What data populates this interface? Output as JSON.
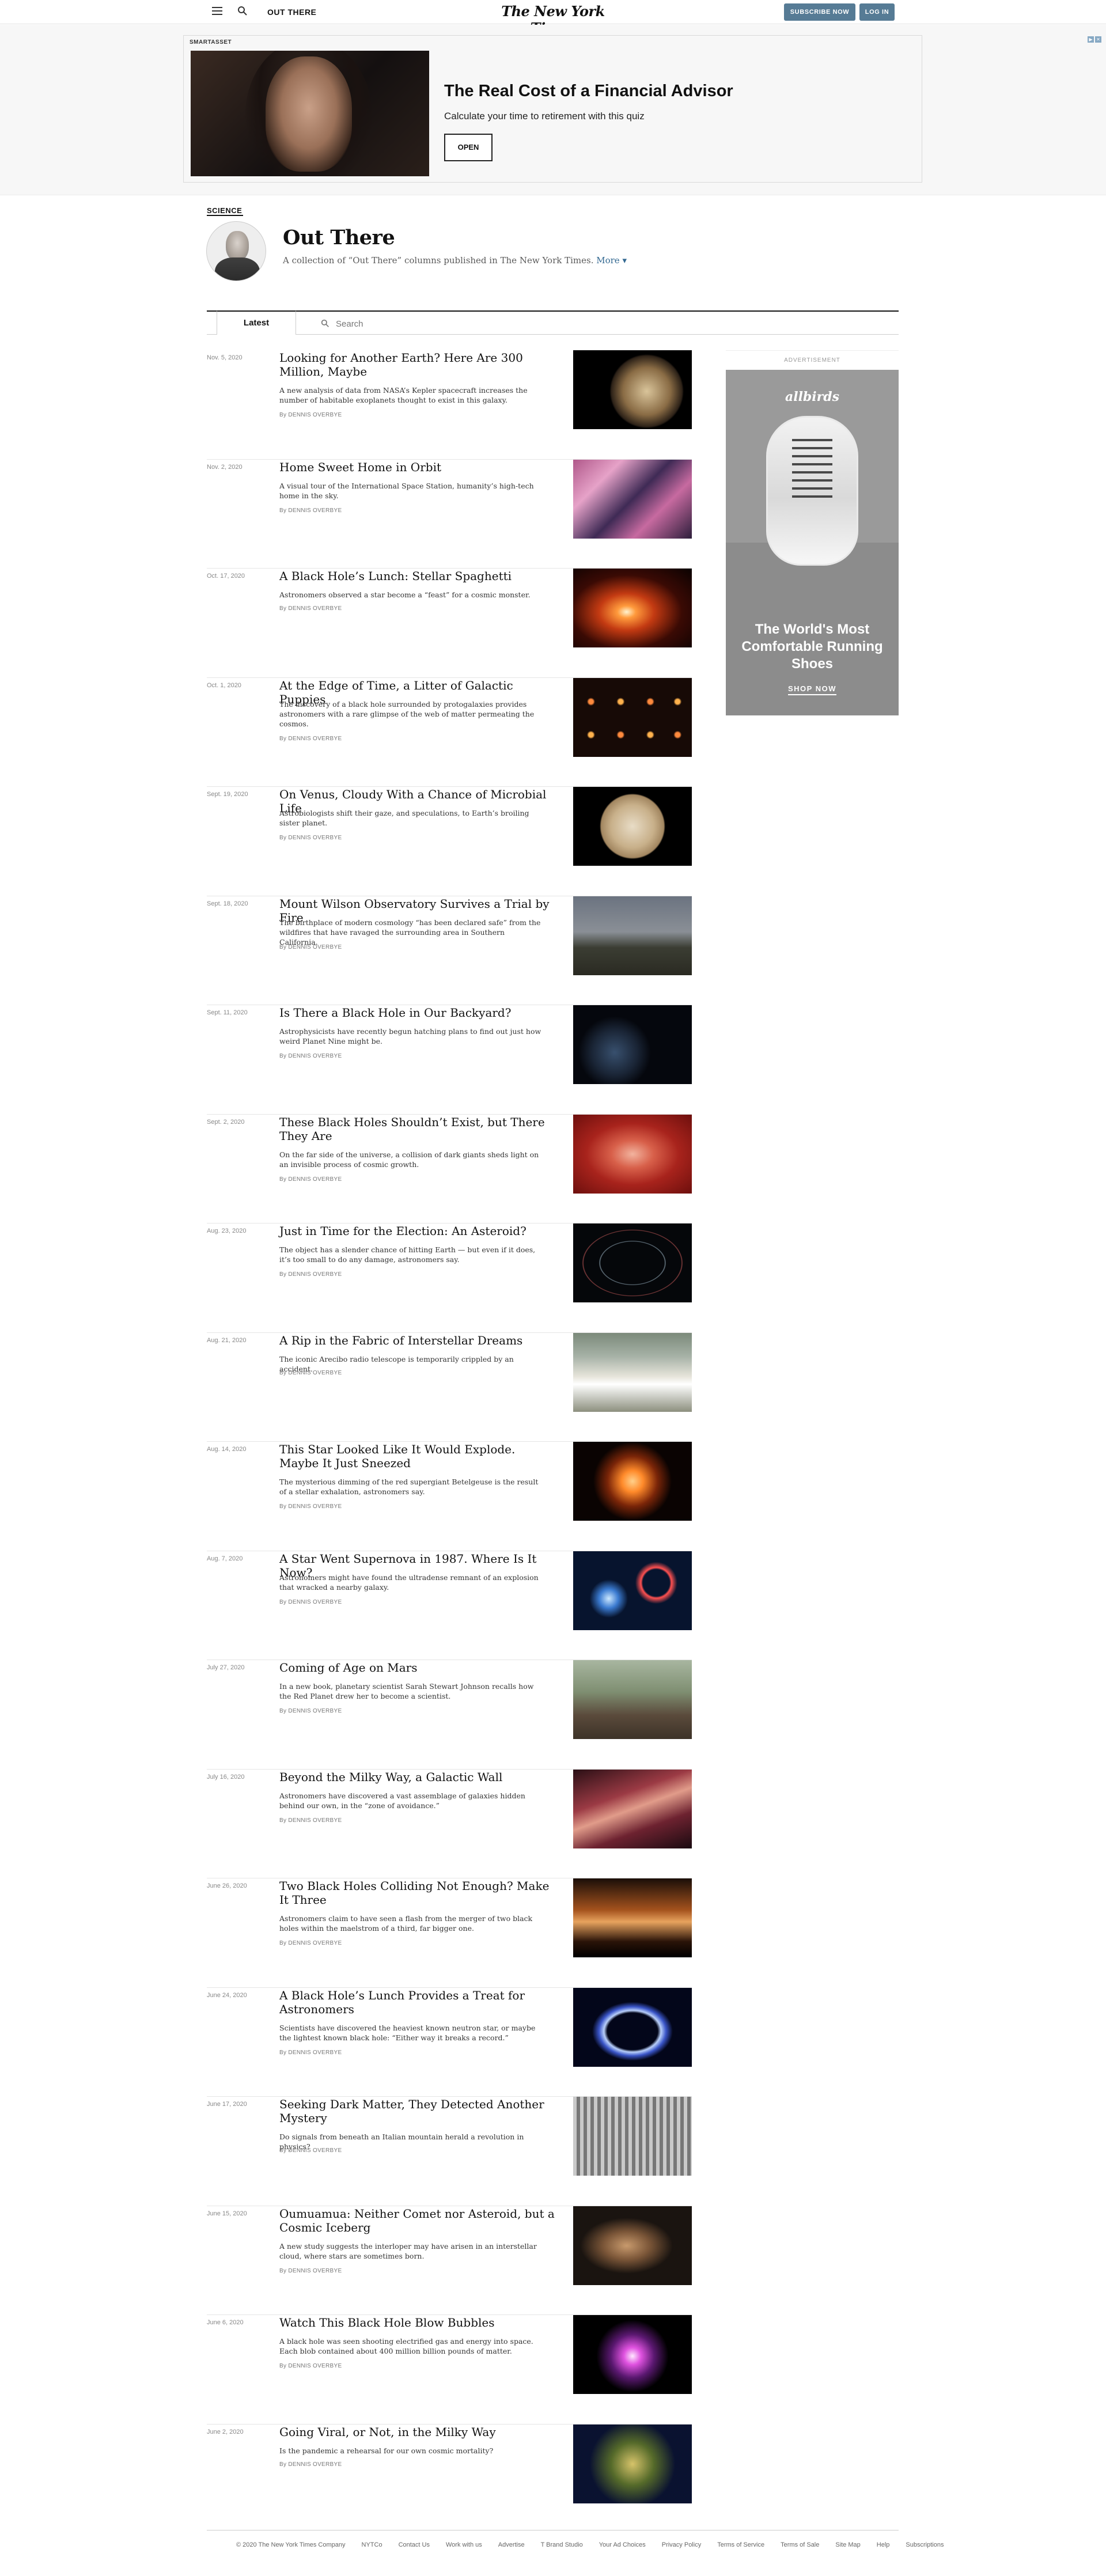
{
  "topbar": {
    "section_label": "OUT THERE",
    "logo": "The New York Times",
    "subscribe_label": "SUBSCRIBE NOW",
    "login_label": "LOG IN",
    "button_color": "#567b95"
  },
  "ad": {
    "tag": "SMARTASSET",
    "title": "The Real Cost of a Financial Advisor",
    "subtitle": "Calculate your time to retirement with this quiz",
    "button_label": "OPEN"
  },
  "column": {
    "kicker": "SCIENCE",
    "title": "Out There",
    "description": "A collection of “Out There” columns published in The New York Times.",
    "more_label": "More"
  },
  "tabs": {
    "latest_label": "Latest",
    "search_placeholder": "Search"
  },
  "articles": [
    {
      "date": "Nov. 5, 2020",
      "title": "Looking for Another Earth? Here Are 300 Million, Maybe",
      "summary": "A new analysis of data from NASA’s Kepler spacecraft increases the number of habitable exoplanets thought to exist in this galaxy.",
      "byline": "By DENNIS OVERBYE"
    },
    {
      "date": "Nov. 2, 2020",
      "title": "Home Sweet Home in Orbit",
      "summary": "A visual tour of the International Space Station, humanity’s high-tech home in the sky.",
      "byline": "By DENNIS OVERBYE"
    },
    {
      "date": "Oct. 17, 2020",
      "title": "A Black Hole’s Lunch: Stellar Spaghetti",
      "summary": "Astronomers observed a star become a “feast” for a cosmic monster.",
      "byline": "By DENNIS OVERBYE"
    },
    {
      "date": "Oct. 1, 2020",
      "title": "At the Edge of Time, a Litter of Galactic Puppies",
      "summary": "The discovery of a black hole surrounded by protogalaxies provides astronomers with a rare glimpse of the web of matter permeating the cosmos.",
      "byline": "By DENNIS OVERBYE"
    },
    {
      "date": "Sept. 19, 2020",
      "title": "On Venus, Cloudy With a Chance of Microbial Life",
      "summary": "Astrobiologists shift their gaze, and speculations, to Earth’s broiling sister planet.",
      "byline": "By DENNIS OVERBYE"
    },
    {
      "date": "Sept. 18, 2020",
      "title": "Mount Wilson Observatory Survives a Trial by Fire",
      "summary": "The birthplace of modern cosmology “has been declared safe” from the wildfires that have ravaged the surrounding area in Southern California.",
      "byline": "By DENNIS OVERBYE"
    },
    {
      "date": "Sept. 11, 2020",
      "title": "Is There a Black Hole in Our Backyard?",
      "summary": "Astrophysicists have recently begun hatching plans to find out just how weird Planet Nine might be.",
      "byline": "By DENNIS OVERBYE"
    },
    {
      "date": "Sept. 2, 2020",
      "title": "These Black Holes Shouldn’t Exist, but There They Are",
      "summary": "On the far side of the universe, a collision of dark giants sheds light on an invisible process of cosmic growth.",
      "byline": "By DENNIS OVERBYE"
    },
    {
      "date": "Aug. 23, 2020",
      "title": "Just in Time for the Election: An Asteroid?",
      "summary": "The object has a slender chance of hitting Earth — but even if it does, it’s too small to do any damage, astronomers say.",
      "byline": "By DENNIS OVERBYE"
    },
    {
      "date": "Aug. 21, 2020",
      "title": "A Rip in the Fabric of Interstellar Dreams",
      "summary": "The iconic Arecibo radio telescope is temporarily crippled by an accident.",
      "byline": "By DENNIS OVERBYE"
    },
    {
      "date": "Aug. 14, 2020",
      "title": "This Star Looked Like It Would Explode. Maybe It Just Sneezed",
      "summary": "The mysterious dimming of the red supergiant Betelgeuse is the result of a stellar exhalation, astronomers say.",
      "byline": "By DENNIS OVERBYE"
    },
    {
      "date": "Aug. 7, 2020",
      "title": "A Star Went Supernova in 1987. Where Is It Now?",
      "summary": "Astronomers might have found the ultradense remnant of an explosion that wracked a nearby galaxy.",
      "byline": "By DENNIS OVERBYE"
    },
    {
      "date": "July 27, 2020",
      "title": "Coming of Age on Mars",
      "summary": "In a new book, planetary scientist Sarah Stewart Johnson recalls how the Red Planet drew her to become a scientist.",
      "byline": "By DENNIS OVERBYE"
    },
    {
      "date": "July 16, 2020",
      "title": "Beyond the Milky Way, a Galactic Wall",
      "summary": "Astronomers have discovered a vast assemblage of galaxies hidden behind our own, in the “zone of avoidance.”",
      "byline": "By DENNIS OVERBYE"
    },
    {
      "date": "June 26, 2020",
      "title": "Two Black Holes Colliding Not Enough? Make It Three",
      "summary": "Astronomers claim to have seen a flash from the merger of two black holes within the maelstrom of a third, far bigger one.",
      "byline": "By DENNIS OVERBYE"
    },
    {
      "date": "June 24, 2020",
      "title": "A Black Hole’s Lunch Provides a Treat for Astronomers",
      "summary": "Scientists have discovered the heaviest known neutron star, or maybe the lightest known black hole: “Either way it breaks a record.”",
      "byline": "By DENNIS OVERBYE"
    },
    {
      "date": "June 17, 2020",
      "title": "Seeking Dark Matter, They Detected Another Mystery",
      "summary": "Do signals from beneath an Italian mountain herald a revolution in physics?",
      "byline": "By DENNIS OVERBYE"
    },
    {
      "date": "June 15, 2020",
      "title": "Oumuamua: Neither Comet nor Asteroid, but a Cosmic Iceberg",
      "summary": "A new study suggests the interloper may have arisen in an interstellar cloud, where stars are sometimes born.",
      "byline": "By DENNIS OVERBYE"
    },
    {
      "date": "June 6, 2020",
      "title": "Watch This Black Hole Blow Bubbles",
      "summary": "A black hole was seen shooting electrified gas and energy into space. Each blob contained about 400 million billion pounds of matter.",
      "byline": "By DENNIS OVERBYE"
    },
    {
      "date": "June 2, 2020",
      "title": "Going Viral, or Not, in the Milky Way",
      "summary": "Is the pandemic a rehearsal for our own cosmic mortality?",
      "byline": "By DENNIS OVERBYE"
    }
  ],
  "rail_ad": {
    "label": "ADVERTISEMENT",
    "brand": "allbirds",
    "headline": "The World's Most Comfortable Running Shoes",
    "cta": "SHOP NOW"
  },
  "footer": {
    "links": [
      "© 2020 The New York Times Company",
      "NYTCo",
      "Contact Us",
      "Work with us",
      "Advertise",
      "T Brand Studio",
      "Your Ad Choices",
      "Privacy Policy",
      "Terms of Service",
      "Terms of Sale",
      "Site Map",
      "Help",
      "Subscriptions"
    ]
  }
}
